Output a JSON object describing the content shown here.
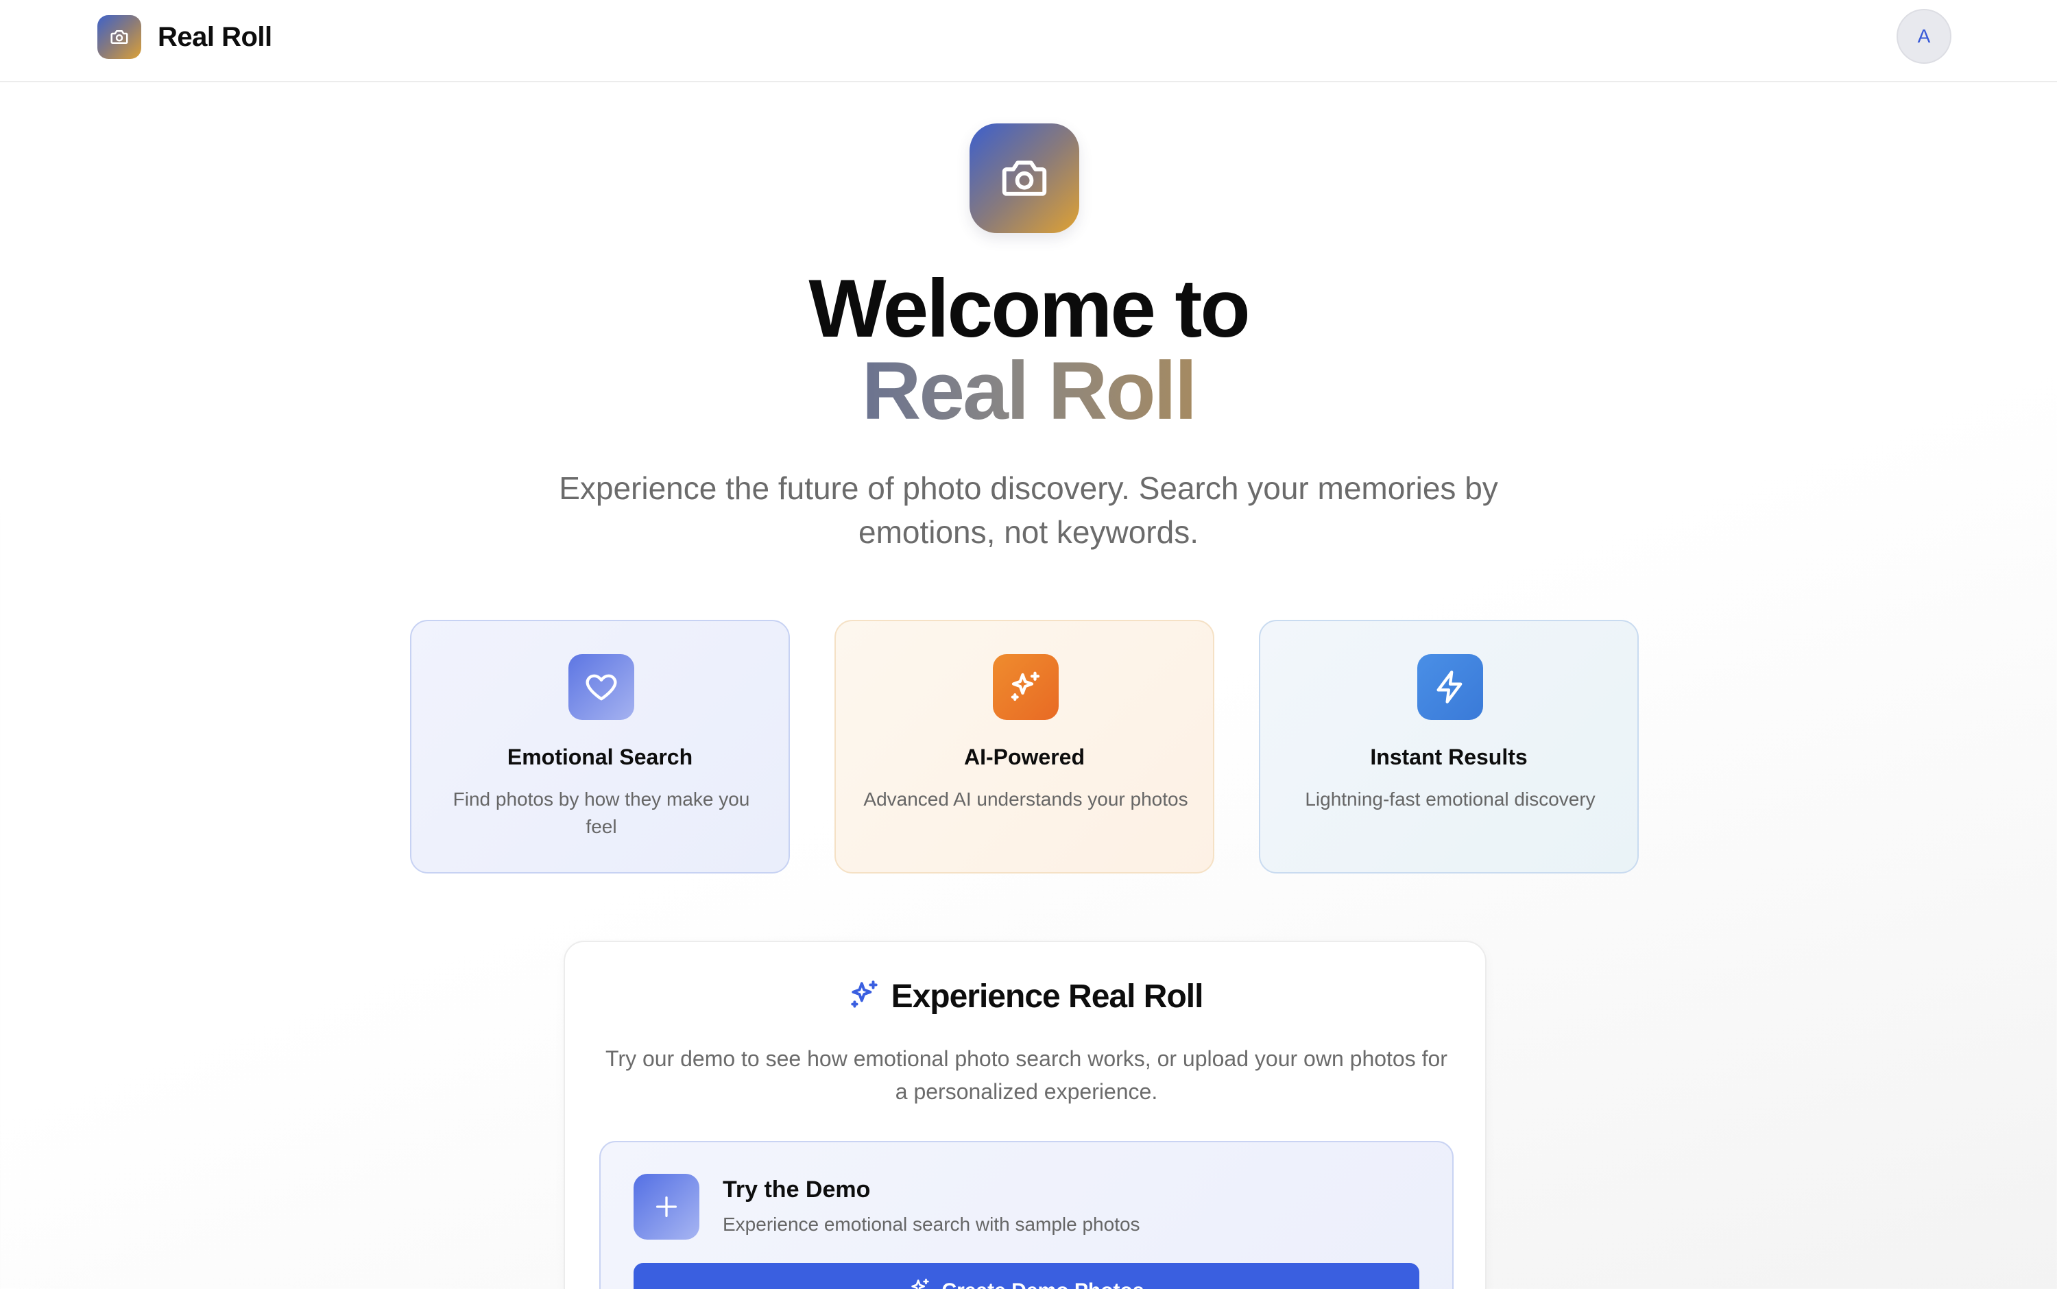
{
  "header": {
    "brand_name": "Real Roll",
    "logo_icon": "camera-icon",
    "avatar_initial": "A"
  },
  "hero": {
    "icon": "camera-icon",
    "title_line1": "Welcome to",
    "title_line2": "Real Roll",
    "subtitle": "Experience the future of photo discovery. Search your memories by emotions, not keywords."
  },
  "features": [
    {
      "icon": "heart-icon",
      "title": "Emotional Search",
      "description": "Find photos by how they make you feel"
    },
    {
      "icon": "sparkles-icon",
      "title": "AI-Powered",
      "description": "Advanced AI understands your photos"
    },
    {
      "icon": "lightning-icon",
      "title": "Instant Results",
      "description": "Lightning-fast emotional discovery"
    }
  ],
  "experience": {
    "icon": "sparkles-icon",
    "heading": "Experience Real Roll",
    "description": "Try our demo to see how emotional photo search works, or upload your own photos for a personalized experience.",
    "demo": {
      "icon": "plus-icon",
      "title": "Try the Demo",
      "subtitle": "Experience emotional search with sample photos",
      "button_icon": "sparkles-icon",
      "button_label": "Create Demo Photos"
    }
  },
  "colors": {
    "accent_blue": "#3a5fe0",
    "brand_gradient_start": "#3e62c9",
    "brand_gradient_end": "#dca136",
    "ai_orange": "#ef8c2e"
  }
}
